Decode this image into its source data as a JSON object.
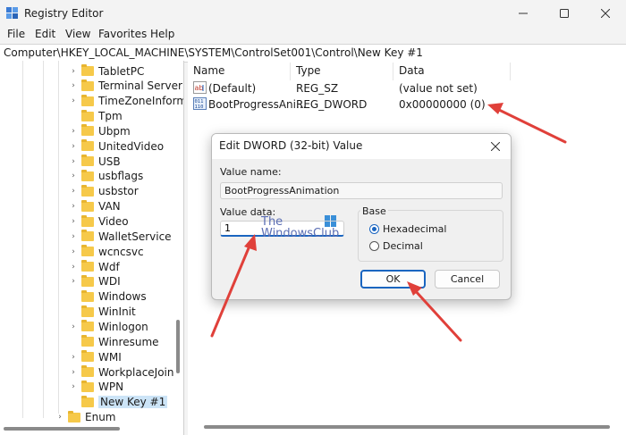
{
  "window": {
    "title": "Registry Editor",
    "controls": [
      "minimize-icon",
      "maximize-icon",
      "close-icon"
    ]
  },
  "menu": [
    "File",
    "Edit",
    "View",
    "Favorites",
    "Help"
  ],
  "address": "Computer\\HKEY_LOCAL_MACHINE\\SYSTEM\\ControlSet001\\Control\\New Key #1",
  "tree": {
    "items": [
      "TabletPC",
      "Terminal Server",
      "TimeZoneInform",
      "Tpm",
      "Ubpm",
      "UnitedVideo",
      "USB",
      "usbflags",
      "usbstor",
      "VAN",
      "Video",
      "WalletService",
      "wcncsvc",
      "Wdf",
      "WDI",
      "Windows",
      "WinInit",
      "Winlogon",
      "Winresume",
      "WMI",
      "WorkplaceJoin",
      "WPN",
      "New Key #1"
    ],
    "expandable": [
      true,
      true,
      true,
      false,
      true,
      true,
      true,
      true,
      true,
      true,
      true,
      true,
      true,
      true,
      true,
      false,
      false,
      true,
      false,
      true,
      true,
      true,
      false
    ],
    "selected": "New Key #1",
    "parent_item": "Enum"
  },
  "list": {
    "columns": [
      "Name",
      "Type",
      "Data"
    ],
    "rows": [
      {
        "icon": "string-value-icon",
        "name": "(Default)",
        "type": "REG_SZ",
        "data": "(value not set)"
      },
      {
        "icon": "binary-value-icon",
        "name": "BootProgressAni...",
        "type": "REG_DWORD",
        "data": "0x00000000 (0)"
      }
    ]
  },
  "dialog": {
    "title": "Edit DWORD (32-bit) Value",
    "value_name_label": "Value name:",
    "value_name": "BootProgressAnimation",
    "value_data_label": "Value data:",
    "value_data": "1",
    "base_label": "Base",
    "radios": [
      {
        "label": "Hexadecimal",
        "checked": true
      },
      {
        "label": "Decimal",
        "checked": false
      }
    ],
    "ok_label": "OK",
    "cancel_label": "Cancel"
  },
  "watermark": {
    "line1": "The",
    "line2": "WindowsClub"
  },
  "colors": {
    "accent": "#1a65c0",
    "arrow": "#e0403a",
    "folder": "#f6c94a"
  }
}
